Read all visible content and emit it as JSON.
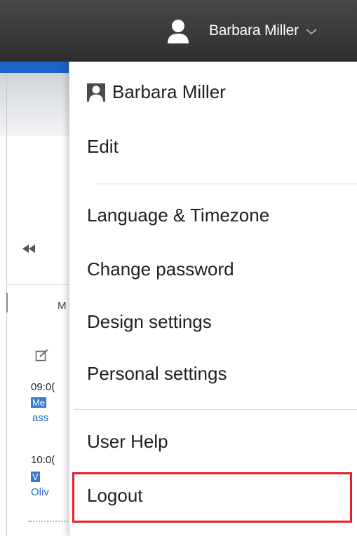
{
  "header": {
    "user_name": "Barbara Miller",
    "avatar_icon": "user-silhouette-icon",
    "dropdown_icon": "chevron-down-icon"
  },
  "background": {
    "rewind_icon": "double-left-arrow-icon",
    "column_label": "M",
    "edit_icon": "edit-icon",
    "events": [
      {
        "time": "09:0(",
        "chip": "Me",
        "link": "ass"
      },
      {
        "time": "10:0(",
        "chip": "V",
        "link": "Oliv"
      }
    ]
  },
  "menu": {
    "user_name": "Barbara Miller",
    "edit": "Edit",
    "language_timezone": "Language & Timezone",
    "change_password": "Change password",
    "design_settings": "Design settings",
    "personal_settings": "Personal settings",
    "user_help": "User Help",
    "logout": "Logout"
  },
  "colors": {
    "topbar": "#3a3a3a",
    "highlight_border": "#e41e2b",
    "accent_blue": "#1b63c9"
  }
}
